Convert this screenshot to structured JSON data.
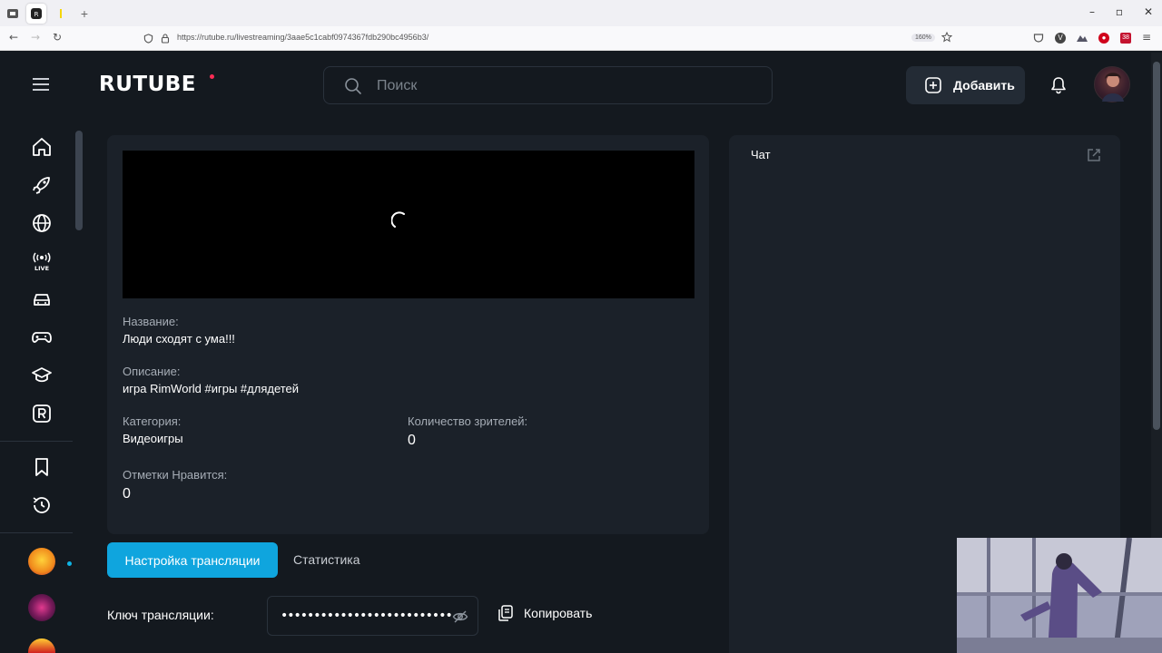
{
  "browser": {
    "url": "https://rutube.ru/livestreaming/3aae5c1cabf0974367fdb290bc4956b3/",
    "zoom": "160%",
    "ext_badge": "38"
  },
  "header": {
    "logo": "RUTUBE",
    "search_placeholder": "Поиск",
    "add_label": "Добавить"
  },
  "stream": {
    "title_label": "Название:",
    "title_value": "Люди сходят с ума!!!",
    "description_label": "Описание:",
    "description_value": "игра RimWorld #игры #длядетей",
    "category_label": "Категория:",
    "category_value": "Видеоигры",
    "viewers_label": "Количество зрителей:",
    "viewers_value": "0",
    "likes_label": "Отметки Нравится:",
    "likes_value": "0"
  },
  "tabs": {
    "settings": "Настройка трансляции",
    "stats": "Статистика"
  },
  "key": {
    "label": "Ключ трансляции:",
    "value": "••••••••••••••••••••••••••",
    "copy": "Копировать"
  },
  "chat": {
    "title": "Чат"
  },
  "colors": {
    "accent": "#0fa5de",
    "background": "#14191f",
    "panel": "#1b2129",
    "logo_dot": "#ff2c55"
  },
  "sidebar_icons": [
    "home-icon",
    "rocket-icon",
    "globe-icon",
    "live-icon",
    "car-icon",
    "gamepad-icon",
    "education-icon",
    "rutube-r-icon",
    "bookmark-icon",
    "history-icon"
  ]
}
